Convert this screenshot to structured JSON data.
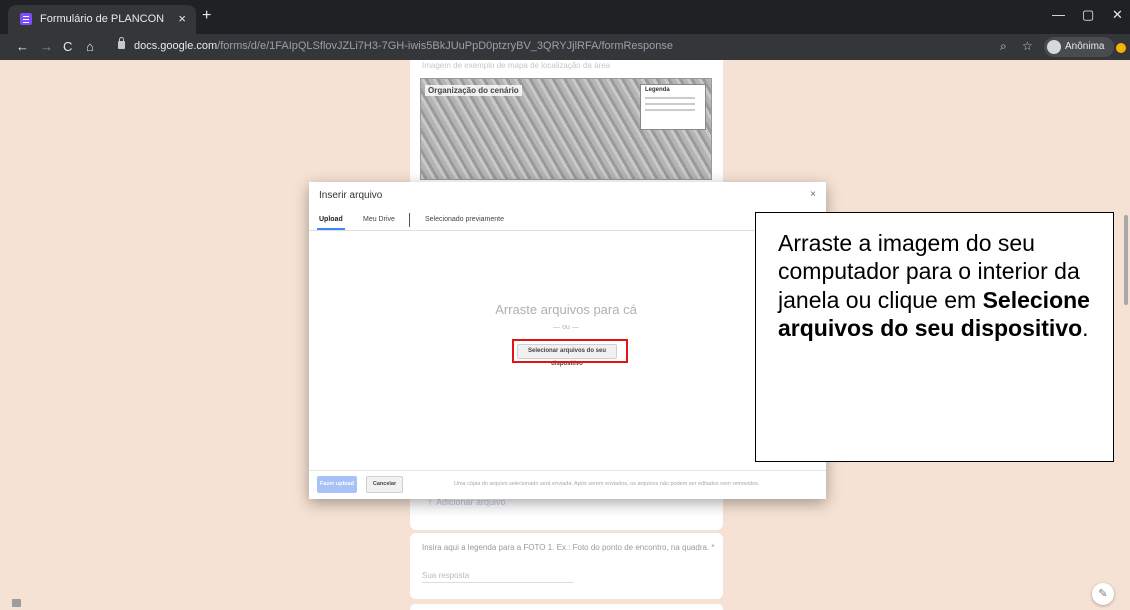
{
  "browser": {
    "tab_title": "Formulário de PLANCON",
    "tab_close": "×",
    "new_tab": "+",
    "window_controls": {
      "minimize": "—",
      "maximize": "▢",
      "close": "✕"
    },
    "url_host": "docs.google.com",
    "url_path": "/forms/d/e/1FAIpQLSflovJZLi7H3-7GH-iwis5BkJUuPpD0ptzryBV_3QRYJjlRFA/formResponse",
    "profile_label": "Anônima",
    "nav": {
      "back": "←",
      "forward": "→",
      "reload": "C",
      "home": "⌂"
    },
    "zoom_icon": "⌕",
    "star_icon": "☆"
  },
  "form": {
    "image_hint": "Imagem de exemplo de mapa de localização da área",
    "map_title": "Organização do cenário",
    "map_legend_title": "Legenda",
    "add_file_label": "Adicionar arquivo",
    "caption_question": "Insira aqui a legenda para a FOTO 1. Ex.: Foto do ponto de encontro, na quadra. *",
    "answer_placeholder": "Sua resposta"
  },
  "dialog": {
    "title": "Inserir arquivo",
    "close": "×",
    "tabs": [
      "Upload",
      "Meu Drive",
      "Selecionado previamente"
    ],
    "drop_text": "Arraste arquivos para cá",
    "or_text": "— ou —",
    "select_button": "Selecionar arquivos do seu dispositivo",
    "upload_button": "Fazer upload",
    "cancel_button": "Cancelar",
    "footer_note": "Uma cópia do arquivo selecionado será enviada. Após serem enviados, os arquivos não podem ser editados nem removidos."
  },
  "callout": {
    "text_1": "Arraste a imagem do seu computador para o interior da janela ou clique em ",
    "text_bold": "Selecione arquivos do seu dispositivo",
    "text_2": "."
  },
  "colors": {
    "page_bg": "#f6e2d4",
    "highlight": "#e01414",
    "accent": "#4285f4"
  }
}
